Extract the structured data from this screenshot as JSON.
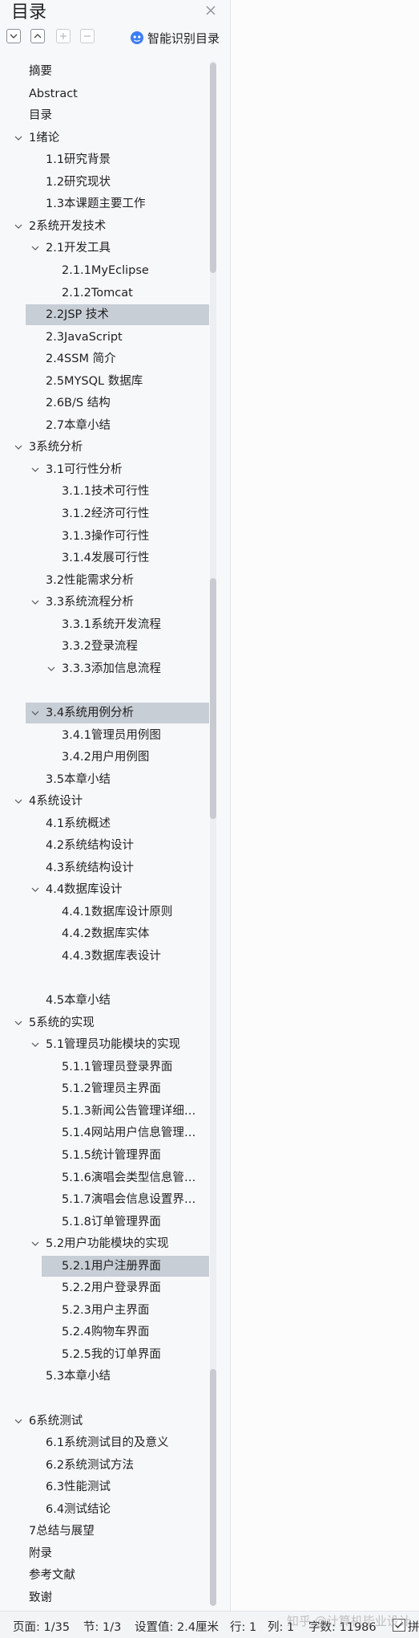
{
  "panel": {
    "title": "目录",
    "smart_label": "智能识别目录"
  },
  "toc": [
    {
      "label": "摘要",
      "level": 0,
      "chev": false
    },
    {
      "label": "Abstract",
      "level": 0,
      "chev": false
    },
    {
      "label": "目录",
      "level": 0,
      "chev": false
    },
    {
      "label": "1绪论",
      "level": 0,
      "chev": true
    },
    {
      "label": "1.1研究背景",
      "level": 1,
      "chev": false
    },
    {
      "label": "1.2研究现状",
      "level": 1,
      "chev": false
    },
    {
      "label": "1.3本课题主要工作",
      "level": 1,
      "chev": false
    },
    {
      "label": "2系统开发技术",
      "level": 0,
      "chev": true
    },
    {
      "label": "2.1开发工具",
      "level": 1,
      "chev": true
    },
    {
      "label": "2.1.1MyEclipse",
      "level": 2,
      "chev": false
    },
    {
      "label": "2.1.2Tomcat",
      "level": 2,
      "chev": false
    },
    {
      "label": "2.2JSP 技术",
      "level": 1,
      "chev": false,
      "selected": true
    },
    {
      "label": "2.3JavaScript",
      "level": 1,
      "chev": false
    },
    {
      "label": "2.4SSM 简介",
      "level": 1,
      "chev": false
    },
    {
      "label": "2.5MYSQL 数据库",
      "level": 1,
      "chev": false
    },
    {
      "label": "2.6B/S 结构",
      "level": 1,
      "chev": false
    },
    {
      "label": "2.7本章小结",
      "level": 1,
      "chev": false
    },
    {
      "label": "3系统分析",
      "level": 0,
      "chev": true
    },
    {
      "label": "3.1可行性分析",
      "level": 1,
      "chev": true
    },
    {
      "label": "3.1.1技术可行性",
      "level": 2,
      "chev": false
    },
    {
      "label": "3.1.2经济可行性",
      "level": 2,
      "chev": false
    },
    {
      "label": "3.1.3操作可行性",
      "level": 2,
      "chev": false
    },
    {
      "label": "3.1.4发展可行性",
      "level": 2,
      "chev": false
    },
    {
      "label": "3.2性能需求分析",
      "level": 1,
      "chev": false
    },
    {
      "label": "3.3系统流程分析",
      "level": 1,
      "chev": true
    },
    {
      "label": "3.3.1系统开发流程",
      "level": 2,
      "chev": false
    },
    {
      "label": "3.3.2登录流程",
      "level": 2,
      "chev": false
    },
    {
      "label": "3.3.3添加信息流程",
      "level": 2,
      "chev": true
    },
    {
      "label": "",
      "level": 2,
      "chev": false
    },
    {
      "label": "3.4系统用例分析",
      "level": 1,
      "chev": true,
      "selected": true
    },
    {
      "label": "3.4.1管理员用例图",
      "level": 2,
      "chev": false
    },
    {
      "label": "3.4.2用户用例图",
      "level": 2,
      "chev": false
    },
    {
      "label": "3.5本章小结",
      "level": 1,
      "chev": false
    },
    {
      "label": "4系统设计",
      "level": 0,
      "chev": true
    },
    {
      "label": "4.1系统概述",
      "level": 1,
      "chev": false
    },
    {
      "label": "4.2系统结构设计",
      "level": 1,
      "chev": false
    },
    {
      "label": "4.3系统结构设计",
      "level": 1,
      "chev": false
    },
    {
      "label": "4.4数据库设计",
      "level": 1,
      "chev": true
    },
    {
      "label": "4.4.1数据库设计原则",
      "level": 2,
      "chev": false
    },
    {
      "label": "4.4.2数据库实体",
      "level": 2,
      "chev": false
    },
    {
      "label": "4.4.3数据库表设计",
      "level": 2,
      "chev": false
    },
    {
      "label": "",
      "level": 2,
      "chev": false
    },
    {
      "label": "4.5本章小结",
      "level": 1,
      "chev": false
    },
    {
      "label": "5系统的实现",
      "level": 0,
      "chev": true
    },
    {
      "label": "5.1管理员功能模块的实现",
      "level": 1,
      "chev": true
    },
    {
      "label": "5.1.1管理员登录界面",
      "level": 2,
      "chev": false
    },
    {
      "label": "5.1.2管理员主界面",
      "level": 2,
      "chev": false
    },
    {
      "label": "5.1.3新闻公告管理详细…",
      "level": 2,
      "chev": false
    },
    {
      "label": "5.1.4网站用户信息管理…",
      "level": 2,
      "chev": false
    },
    {
      "label": "5.1.5统计管理界面",
      "level": 2,
      "chev": false
    },
    {
      "label": "5.1.6演唱会类型信息管…",
      "level": 2,
      "chev": false
    },
    {
      "label": "5.1.7演唱会信息设置界…",
      "level": 2,
      "chev": false
    },
    {
      "label": "5.1.8订单管理界面",
      "level": 2,
      "chev": false
    },
    {
      "label": "5.2用户功能模块的实现",
      "level": 1,
      "chev": true
    },
    {
      "label": "5.2.1用户注册界面",
      "level": 2,
      "chev": false,
      "selected": true
    },
    {
      "label": "5.2.2用户登录界面",
      "level": 2,
      "chev": false
    },
    {
      "label": "5.2.3用户主界面",
      "level": 2,
      "chev": false
    },
    {
      "label": "5.2.4购物车界面",
      "level": 2,
      "chev": false
    },
    {
      "label": "5.2.5我的订单界面",
      "level": 2,
      "chev": false
    },
    {
      "label": "5.3本章小结",
      "level": 1,
      "chev": false
    },
    {
      "label": "",
      "level": 1,
      "chev": false
    },
    {
      "label": "6系统测试",
      "level": 0,
      "chev": true
    },
    {
      "label": "6.1系统测试目的及意义",
      "level": 1,
      "chev": false
    },
    {
      "label": "6.2系统测试方法",
      "level": 1,
      "chev": false
    },
    {
      "label": "6.3性能测试",
      "level": 1,
      "chev": false
    },
    {
      "label": "6.4测试结论",
      "level": 1,
      "chev": false
    },
    {
      "label": "7总结与展望",
      "level": 0,
      "chev": false
    },
    {
      "label": "附录",
      "level": 0,
      "chev": false
    },
    {
      "label": "参考文献",
      "level": 0,
      "chev": false
    },
    {
      "label": "致谢",
      "level": 0,
      "chev": false
    }
  ],
  "status": {
    "page": "页面: 1/35",
    "section": "节: 1/3",
    "setting": "设置值: 2.4厘米",
    "line": "行: 1",
    "column": "列: 1",
    "words": "字数: 11986",
    "spell": "拼"
  },
  "watermark": "知乎 @计算机毕业设计"
}
